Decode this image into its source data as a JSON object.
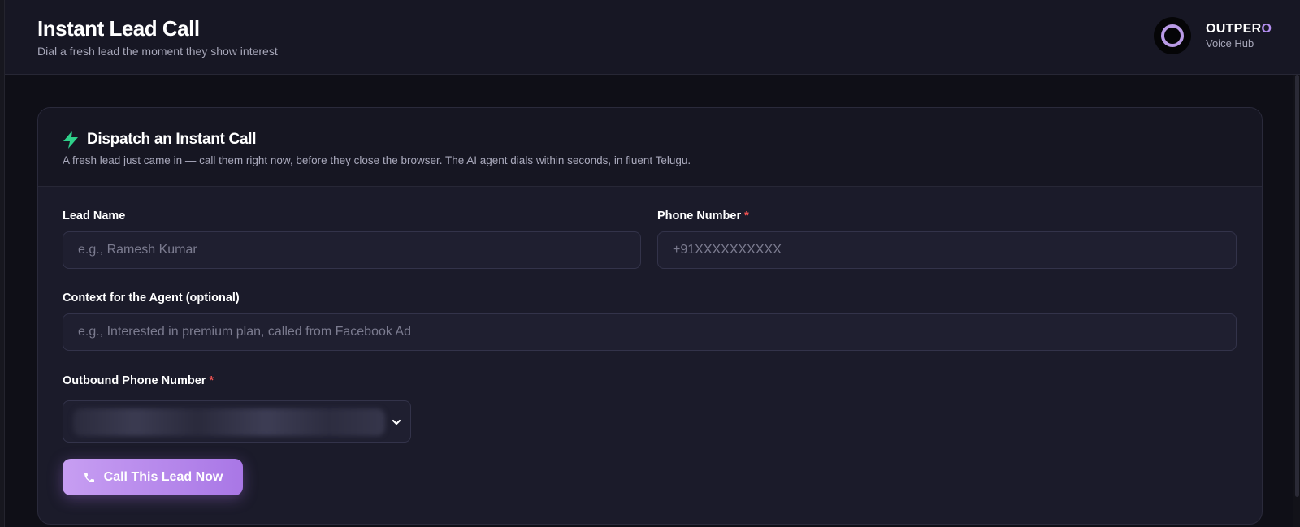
{
  "header": {
    "title": "Instant Lead Call",
    "subtitle": "Dial a fresh lead the moment they show interest"
  },
  "brand": {
    "name_main": "OUTPER",
    "name_accent": "O",
    "sub": "Voice Hub",
    "logo_icon": "ring-logo-icon",
    "accent_color": "#b48ef0"
  },
  "card": {
    "icon": "bolt-icon",
    "icon_color": "#2fd08a",
    "title": "Dispatch an Instant Call",
    "description": "A fresh lead just came in — call them right now, before they close the browser. The AI agent dials within seconds, in fluent Telugu."
  },
  "form": {
    "lead_name": {
      "label": "Lead Name",
      "placeholder": "e.g., Ramesh Kumar",
      "value": ""
    },
    "phone_number": {
      "label": "Phone Number",
      "required_mark": "*",
      "placeholder": "+91XXXXXXXXXX",
      "value": ""
    },
    "context": {
      "label": "Context for the Agent (optional)",
      "placeholder": "e.g., Interested in premium plan, called from Facebook Ad",
      "value": ""
    },
    "outbound_number": {
      "label": "Outbound Phone Number",
      "required_mark": "*",
      "selected_value_redacted": true
    }
  },
  "actions": {
    "call_label": "Call This Lead Now",
    "call_icon": "phone-icon",
    "button_color": "#b88aec"
  }
}
